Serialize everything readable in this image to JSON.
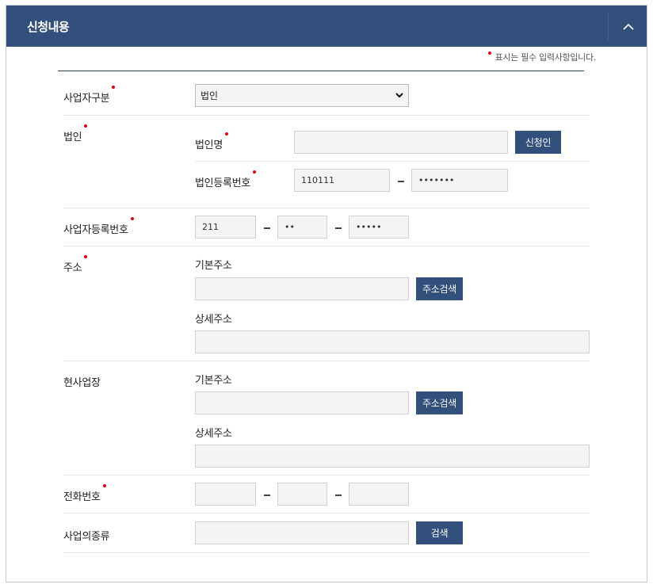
{
  "header": {
    "title": "신청내용"
  },
  "notice": "표시는 필수 입력사항입니다.",
  "business_type": {
    "label": "사업자구분",
    "selected": "법인"
  },
  "corporation": {
    "label": "법인",
    "name_label": "법인명",
    "name_value": "",
    "apply_button": "신청인",
    "reg_no_label": "법인등록번호",
    "reg_no_part1": "110111",
    "reg_no_part2": "•••••••"
  },
  "business_reg_no": {
    "label": "사업자등록번호",
    "part1": "211",
    "part2": "••",
    "part3": "•••••"
  },
  "address": {
    "label": "주소",
    "basic_label": "기본주소",
    "basic_value": "",
    "search_button": "주소검색",
    "detail_label": "상세주소",
    "detail_value": ""
  },
  "site_address": {
    "label": "현사업장",
    "basic_label": "기본주소",
    "basic_value": "",
    "search_button": "주소검색",
    "detail_label": "상세주소",
    "detail_value": ""
  },
  "phone": {
    "label": "전화번호",
    "part1": "",
    "part2": "",
    "part3": ""
  },
  "business_category": {
    "label": "사업의종류",
    "value": "",
    "search_button": "검색"
  },
  "colors": {
    "header_bg": "#334f7b",
    "required_dot": "#e60012",
    "button_bg": "#334f7b"
  }
}
